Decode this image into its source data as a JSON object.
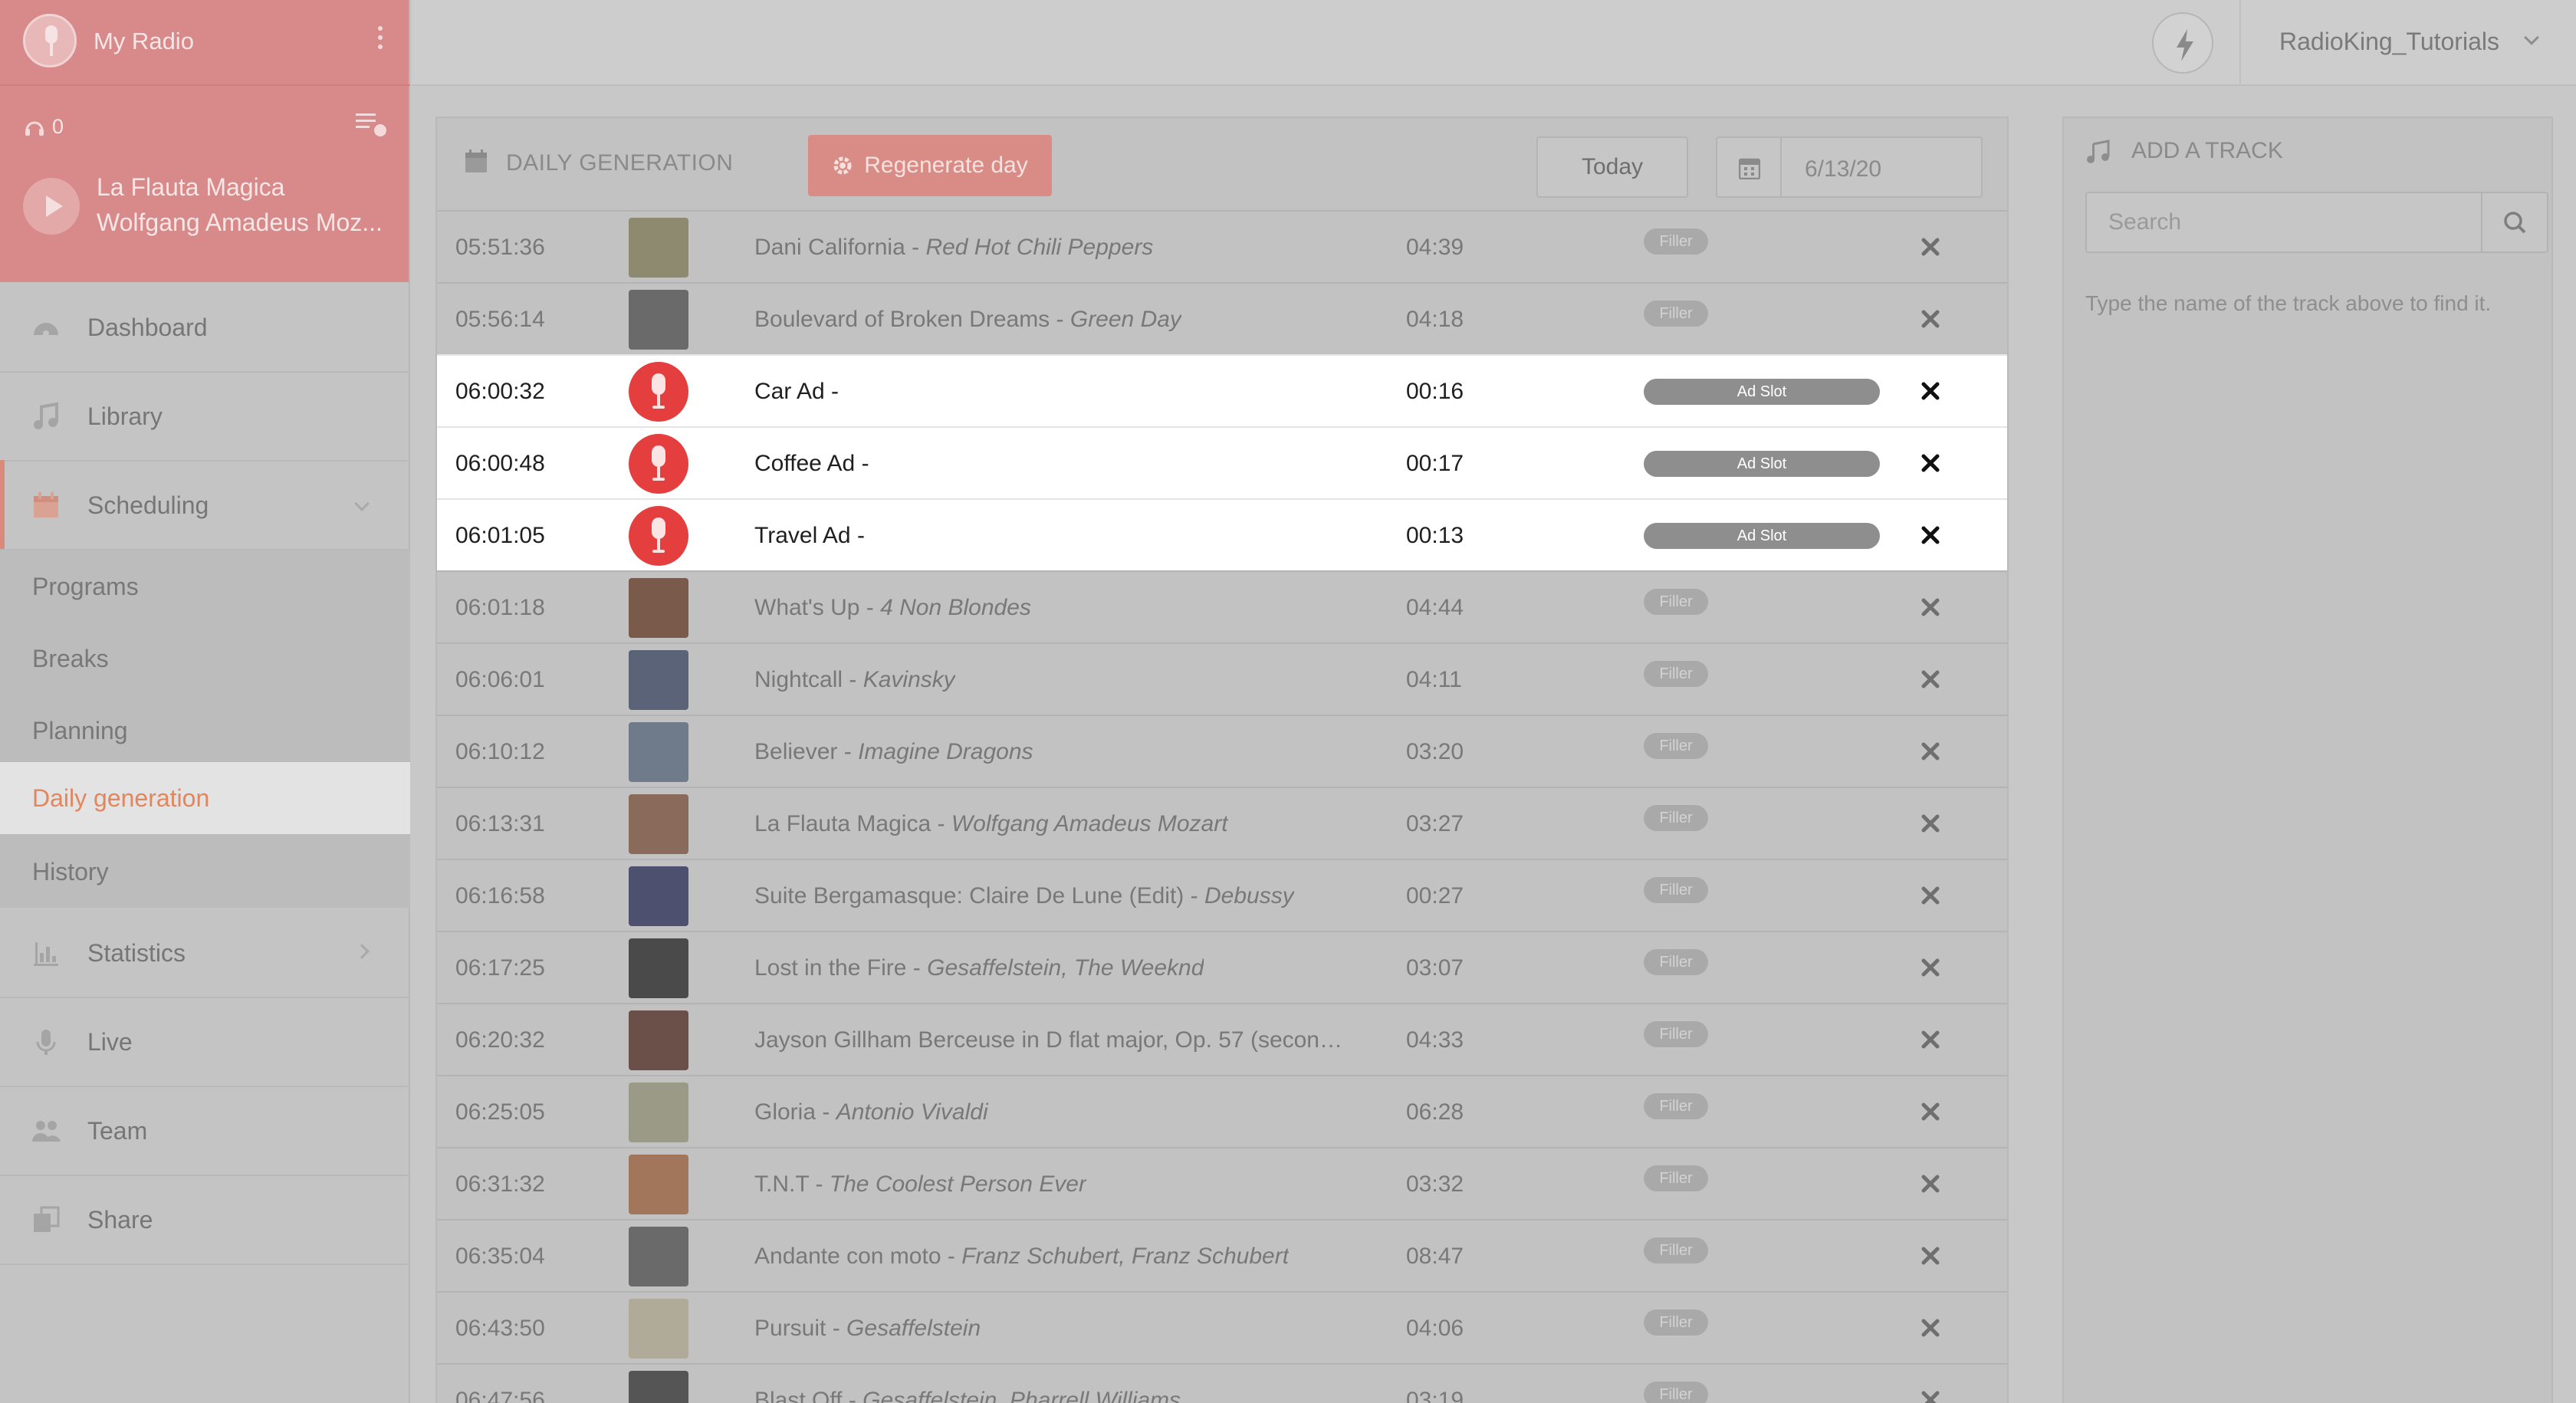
{
  "sidebar": {
    "radio_name": "My Radio",
    "listeners": "0",
    "now_playing": {
      "title": "La Flauta Magica",
      "artist": "Wolfgang Amadeus Moz..."
    },
    "nav": [
      {
        "label": "Dashboard"
      },
      {
        "label": "Library"
      },
      {
        "label": "Scheduling"
      },
      {
        "label": "Statistics"
      },
      {
        "label": "Live"
      },
      {
        "label": "Team"
      },
      {
        "label": "Share"
      }
    ],
    "scheduling_sub": [
      {
        "label": "Programs"
      },
      {
        "label": "Breaks"
      },
      {
        "label": "Planning"
      },
      {
        "label": "Daily generation"
      },
      {
        "label": "History"
      }
    ]
  },
  "topbar": {
    "username": "RadioKing_Tutorials"
  },
  "panel": {
    "title": "DAILY GENERATION",
    "regenerate_label": "Regenerate day",
    "today_label": "Today",
    "date_value": "6/13/20"
  },
  "tracks": [
    {
      "time": "05:51:36",
      "title": "Dani California",
      "artist": "Red Hot Chili Peppers",
      "duration": "04:39",
      "tag": "Filler",
      "type": "filler",
      "cover": "#8d8a70"
    },
    {
      "time": "05:56:14",
      "title": "Boulevard of Broken Dreams",
      "artist": "Green Day",
      "duration": "04:18",
      "tag": "Filler",
      "type": "filler",
      "cover": "#6a6a6a"
    },
    {
      "time": "06:00:32",
      "title": "Car Ad",
      "artist": "",
      "duration": "00:16",
      "tag": "Ad Slot",
      "type": "ad",
      "cover": "#e53e3e"
    },
    {
      "time": "06:00:48",
      "title": "Coffee Ad",
      "artist": "",
      "duration": "00:17",
      "tag": "Ad Slot",
      "type": "ad",
      "cover": "#e53e3e"
    },
    {
      "time": "06:01:05",
      "title": "Travel Ad",
      "artist": "",
      "duration": "00:13",
      "tag": "Ad Slot",
      "type": "ad",
      "cover": "#e53e3e"
    },
    {
      "time": "06:01:18",
      "title": "What's Up",
      "artist": "4 Non Blondes",
      "duration": "04:44",
      "tag": "Filler",
      "type": "filler",
      "cover": "#7a5a4a"
    },
    {
      "time": "06:06:01",
      "title": "Nightcall",
      "artist": "Kavinsky",
      "duration": "04:11",
      "tag": "Filler",
      "type": "filler",
      "cover": "#5b6378"
    },
    {
      "time": "06:10:12",
      "title": "Believer",
      "artist": "Imagine Dragons",
      "duration": "03:20",
      "tag": "Filler",
      "type": "filler",
      "cover": "#6f7a8a"
    },
    {
      "time": "06:13:31",
      "title": "La Flauta Magica",
      "artist": "Wolfgang Amadeus Mozart",
      "duration": "03:27",
      "tag": "Filler",
      "type": "filler",
      "cover": "#8a6a5a"
    },
    {
      "time": "06:16:58",
      "title": "Suite Bergamasque: Claire De Lune (Edit)",
      "artist": "Debussy",
      "duration": "00:27",
      "tag": "Filler",
      "type": "filler",
      "cover": "#4e5070"
    },
    {
      "time": "06:17:25",
      "title": "Lost in the Fire",
      "artist": "Gesaffelstein, The Weeknd",
      "duration": "03:07",
      "tag": "Filler",
      "type": "filler",
      "cover": "#4a4a4a"
    },
    {
      "time": "06:20:32",
      "title": "Jayson Gillham Berceuse in D flat major, Op. 57 (second s...",
      "artist": "",
      "duration": "04:33",
      "tag": "Filler",
      "type": "filler",
      "cover": "#6a5048"
    },
    {
      "time": "06:25:05",
      "title": "Gloria",
      "artist": "Antonio Vivaldi",
      "duration": "06:28",
      "tag": "Filler",
      "type": "filler",
      "cover": "#9a9a86"
    },
    {
      "time": "06:31:32",
      "title": "T.N.T",
      "artist": "The Coolest Person Ever",
      "duration": "03:32",
      "tag": "Filler",
      "type": "filler",
      "cover": "#a2765a"
    },
    {
      "time": "06:35:04",
      "title": "Andante con moto",
      "artist": "Franz Schubert, Franz Schubert",
      "duration": "08:47",
      "tag": "Filler",
      "type": "filler",
      "cover": "#6a6a6a"
    },
    {
      "time": "06:43:50",
      "title": "Pursuit",
      "artist": "Gesaffelstein",
      "duration": "04:06",
      "tag": "Filler",
      "type": "filler",
      "cover": "#b0aa98"
    },
    {
      "time": "06:47:56",
      "title": "Blast Off",
      "artist": "Gesaffelstein, Pharrell Williams",
      "duration": "03:19",
      "tag": "Filler",
      "type": "filler",
      "cover": "#555555"
    }
  ],
  "add_track": {
    "title": "ADD A TRACK",
    "search_placeholder": "Search",
    "hint": "Type the name of the track above to find it."
  },
  "colors": {
    "accent": "#e2865d",
    "ad_red": "#e53e3e",
    "header_pink": "#d88a8a"
  }
}
